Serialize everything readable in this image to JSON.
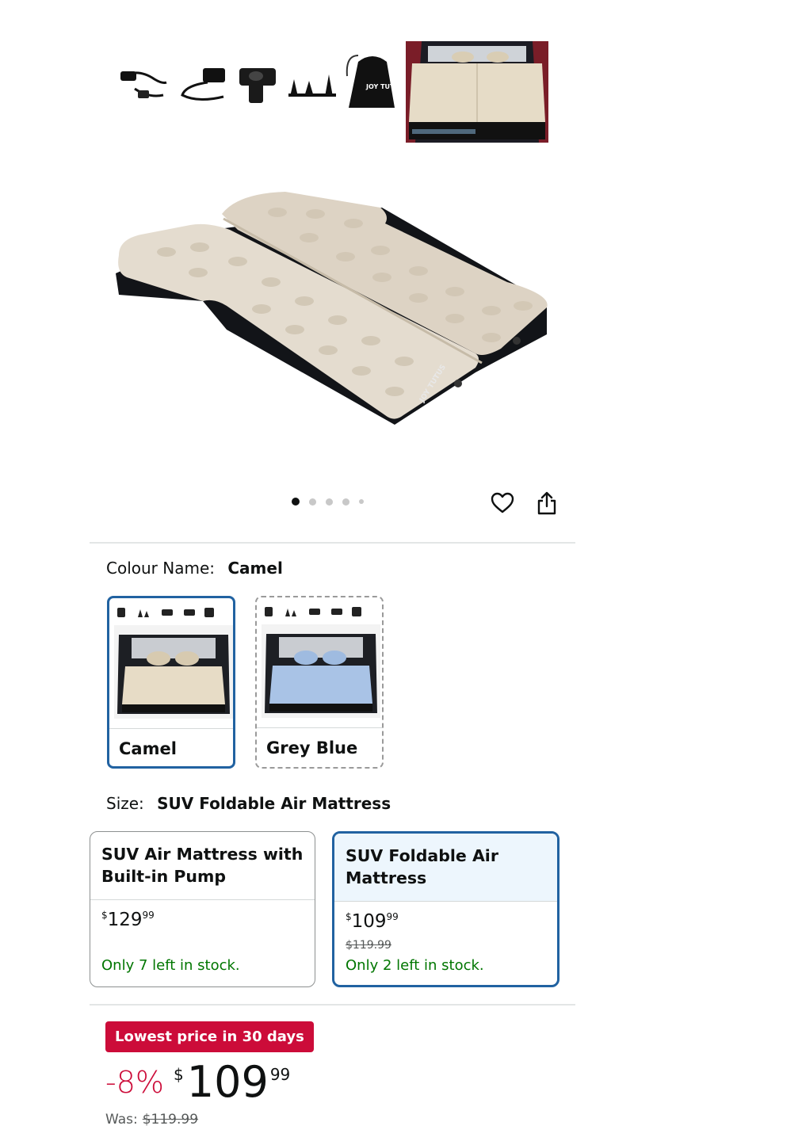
{
  "gallery": {
    "brand_text": "JOY TUTUS",
    "dots_count": 5,
    "active_dot": 0
  },
  "actions": {
    "wishlist_icon": "heart-icon",
    "share_icon": "share-icon"
  },
  "colour": {
    "label": "Colour Name:",
    "selected": "Camel",
    "options": [
      {
        "name": "Camel",
        "state": "selected",
        "mattress_color": "#e7dcc6"
      },
      {
        "name": "Grey Blue",
        "state": "unavailable",
        "mattress_color": "#a9c3e6"
      }
    ]
  },
  "size": {
    "label": "Size:",
    "selected": "SUV Foldable Air Mattress",
    "options": [
      {
        "line1": "SUV Air Mattress with",
        "line2": "Built-in Pump",
        "currency": "$",
        "whole": "129",
        "fraction": "99",
        "was": "",
        "stock": "Only 7 left in stock."
      },
      {
        "line1": "SUV Foldable Air",
        "line2": "Mattress",
        "currency": "$",
        "whole": "109",
        "fraction": "99",
        "was": "$119.99",
        "stock": "Only 2 left in stock."
      }
    ]
  },
  "price": {
    "badge": "Lowest price in 30 days",
    "discount": "-8%",
    "currency": "$",
    "whole": "109",
    "fraction": "99",
    "was_label": "Was:",
    "was_value": "$119.99"
  },
  "colors": {
    "accent_blue": "#2162a1",
    "deal_red": "#cc0c39",
    "stock_green": "#007600"
  }
}
